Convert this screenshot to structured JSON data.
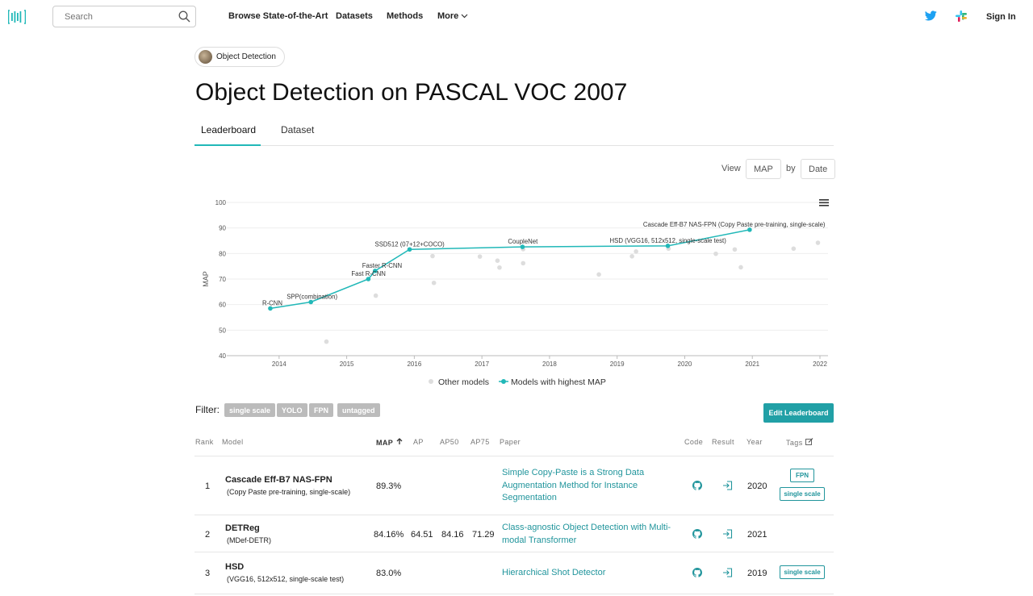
{
  "nav": {
    "search_placeholder": "Search",
    "links": [
      "Browse State-of-the-Art",
      "Datasets",
      "Methods",
      "More"
    ],
    "sign_in": "Sign In",
    "accent": "#21b8b8"
  },
  "task_pill": "Object Detection",
  "title": "Object Detection on PASCAL VOC 2007",
  "tabs": [
    "Leaderboard",
    "Dataset"
  ],
  "view": {
    "view_label": "View",
    "metric": "MAP",
    "by_label": "by",
    "axis": "Date"
  },
  "chart_data": {
    "type": "scatter",
    "title": "",
    "xlabel": "",
    "ylabel": "MAP",
    "ylim": [
      40,
      100
    ],
    "xlim": [
      2013.8,
      2022.1
    ],
    "yticks": [
      40,
      50,
      60,
      70,
      80,
      90,
      100
    ],
    "xticks": [
      "2014",
      "2015",
      "2016",
      "2017",
      "2018",
      "2019",
      "2020",
      "2021",
      "2022"
    ],
    "grid": true,
    "legend_position": "bottom",
    "series": [
      {
        "name": "Models with highest MAP",
        "color": "#21b8b8",
        "points": [
          {
            "x": 2013.87,
            "y": 58.5,
            "label": "R-CNN"
          },
          {
            "x": 2014.47,
            "y": 61.0,
            "label": "SPP(combination)"
          },
          {
            "x": 2015.32,
            "y": 70.0,
            "label": "Fast R-CNN"
          },
          {
            "x": 2015.42,
            "y": 73.2,
            "label": "Faster R-CNN"
          },
          {
            "x": 2015.93,
            "y": 81.6,
            "label": "SSD512 (07+12+COCO)"
          },
          {
            "x": 2017.6,
            "y": 82.6,
            "label": "CoupleNet"
          },
          {
            "x": 2019.75,
            "y": 83.0,
            "label": "HSD (VGG16, 512x512, single-scale test)"
          },
          {
            "x": 2020.96,
            "y": 89.3,
            "label": "Cascade Eff-B7 NAS-FPN (Copy Paste pre-training, single-scale)"
          }
        ]
      },
      {
        "name": "Other models",
        "color": "#dddddd",
        "points": [
          {
            "x": 2014.7,
            "y": 45.5
          },
          {
            "x": 2015.43,
            "y": 63.5
          },
          {
            "x": 2016.27,
            "y": 79.0
          },
          {
            "x": 2016.29,
            "y": 68.5
          },
          {
            "x": 2016.97,
            "y": 78.8
          },
          {
            "x": 2017.23,
            "y": 77.2
          },
          {
            "x": 2017.26,
            "y": 74.5
          },
          {
            "x": 2017.61,
            "y": 81.7
          },
          {
            "x": 2017.61,
            "y": 76.2
          },
          {
            "x": 2018.73,
            "y": 71.8
          },
          {
            "x": 2019.22,
            "y": 78.9
          },
          {
            "x": 2019.28,
            "y": 80.8
          },
          {
            "x": 2019.76,
            "y": 81.9
          },
          {
            "x": 2020.46,
            "y": 79.9
          },
          {
            "x": 2020.74,
            "y": 81.6
          },
          {
            "x": 2020.83,
            "y": 74.6
          },
          {
            "x": 2021.61,
            "y": 81.9
          },
          {
            "x": 2021.97,
            "y": 84.2
          }
        ]
      }
    ]
  },
  "filter": {
    "label": "Filter:",
    "tags": [
      "single scale",
      "YOLO",
      "FPN",
      "untagged"
    ],
    "edit_button": "Edit Leaderboard"
  },
  "table": {
    "headers": [
      "Rank",
      "Model",
      "MAP",
      "AP",
      "AP50",
      "AP75",
      "Paper",
      "Code",
      "Result",
      "Year",
      "Tags"
    ],
    "rows": [
      {
        "rank": "1",
        "model": "Cascade Eff-B7 NAS-FPN",
        "model_sub": "(Copy Paste pre-training, single-scale)",
        "map": "89.3%",
        "ap": "",
        "ap50": "",
        "ap75": "",
        "paper": "Simple Copy-Paste is a Strong Data Augmentation Method for Instance Segmentation",
        "year": "2020",
        "tags": [
          "FPN",
          "single scale"
        ]
      },
      {
        "rank": "2",
        "model": "DETReg",
        "model_sub": "(MDef-DETR)",
        "map": "84.16%",
        "ap": "64.51",
        "ap50": "84.16",
        "ap75": "71.29",
        "paper": "Class-agnostic Object Detection with Multi-modal Transformer",
        "year": "2021",
        "tags": []
      },
      {
        "rank": "3",
        "model": "HSD",
        "model_sub": "(VGG16, 512x512, single-scale test)",
        "map": "83.0%",
        "ap": "",
        "ap50": "",
        "ap75": "",
        "paper": "Hierarchical Shot Detector",
        "year": "2019",
        "tags": [
          "single scale"
        ]
      }
    ]
  }
}
